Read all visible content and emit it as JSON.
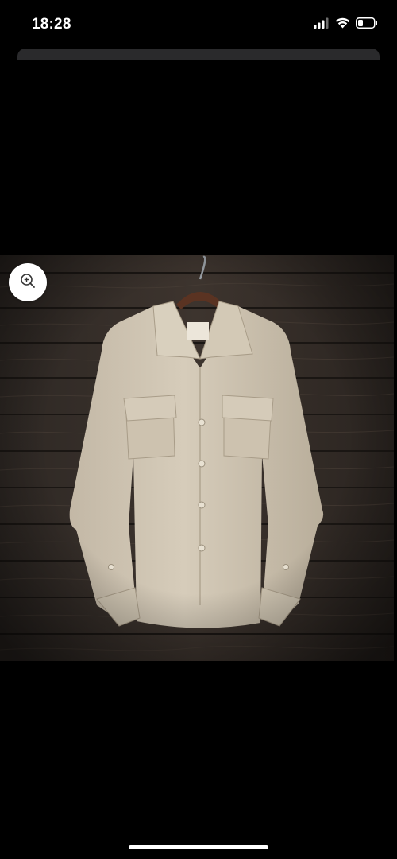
{
  "status_bar": {
    "time": "18:28",
    "icons": [
      "cellular-signal-icon",
      "wifi-icon",
      "battery-icon"
    ]
  },
  "product_image": {
    "subject": "shirt-image",
    "icon": "zoom-in-icon"
  },
  "colors": {
    "background": "#000000",
    "shirt": "#cfc4b1",
    "wood": "#3b322c"
  }
}
